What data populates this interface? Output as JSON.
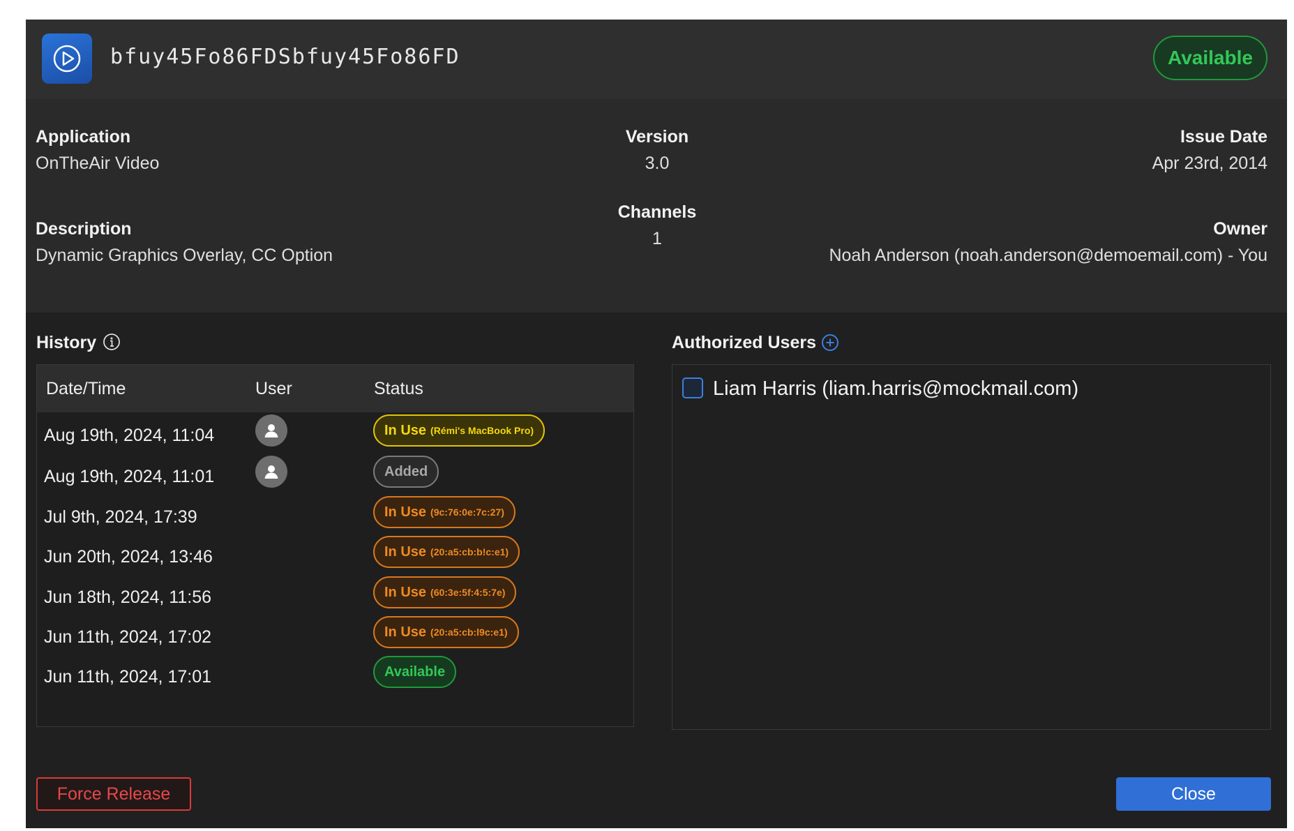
{
  "header": {
    "license_key": "bfuy45Fo86FDSbfuy45Fo86FD",
    "status": "Available",
    "app_icon": "play-circle-icon"
  },
  "info": {
    "application_label": "Application",
    "application_value": "OnTheAir Video",
    "version_label": "Version",
    "version_value": "3.0",
    "issue_date_label": "Issue Date",
    "issue_date_value": "Apr 23rd, 2014",
    "description_label": "Description",
    "description_value": "Dynamic Graphics Overlay, CC Option",
    "channels_label": "Channels",
    "channels_value": "1",
    "owner_label": "Owner",
    "owner_value": "Noah Anderson (noah.anderson@demoemail.com) - You"
  },
  "history": {
    "title": "History",
    "columns": [
      "Date/Time",
      "User",
      "Status"
    ],
    "rows": [
      {
        "date": "Aug 19th, 2024, 11:04",
        "user_icon": "user-avatar-icon",
        "status": "In Use",
        "detail": "(Rémi's MacBook Pro)",
        "color": "#f4d80f"
      },
      {
        "date": "Aug 19th, 2024, 11:01",
        "user_icon": "user-avatar-icon",
        "status": "Added",
        "detail": "",
        "color": "#a8a8a8"
      },
      {
        "date": "Jul 9th, 2024, 17:39",
        "user_icon": "",
        "status": "In Use",
        "detail": "(9c:76:0e:7c:27)",
        "color": "#f08a20"
      },
      {
        "date": "Jun 20th, 2024, 13:46",
        "user_icon": "",
        "status": "In Use",
        "detail": "(20:a5:cb:b!c:e1)",
        "color": "#f08a20"
      },
      {
        "date": "Jun 18th, 2024, 11:56",
        "user_icon": "",
        "status": "In Use",
        "detail": "(60:3e:5f:4:5:7e)",
        "color": "#f08a20"
      },
      {
        "date": "Jun 11th, 2024, 17:02",
        "user_icon": "",
        "status": "In Use",
        "detail": "(20:a5:cb:l9c:e1)",
        "color": "#f08a20"
      },
      {
        "date": "Jun 11th, 2024, 17:01",
        "user_icon": "",
        "status": "Available",
        "detail": "",
        "color": "#34c759"
      }
    ]
  },
  "authorized_users": {
    "title": "Authorized Users",
    "users": [
      {
        "label": "Liam Harris (liam.harris@mockmail.com)",
        "checked": false
      }
    ]
  },
  "footer": {
    "force_release_label": "Force Release",
    "close_label": "Close"
  },
  "colors": {
    "available_green": "#34c759",
    "in_use_yellow": "#f4d80f",
    "in_use_orange": "#f08a20",
    "danger_red": "#e84848",
    "primary_blue": "#2f6fd6"
  }
}
